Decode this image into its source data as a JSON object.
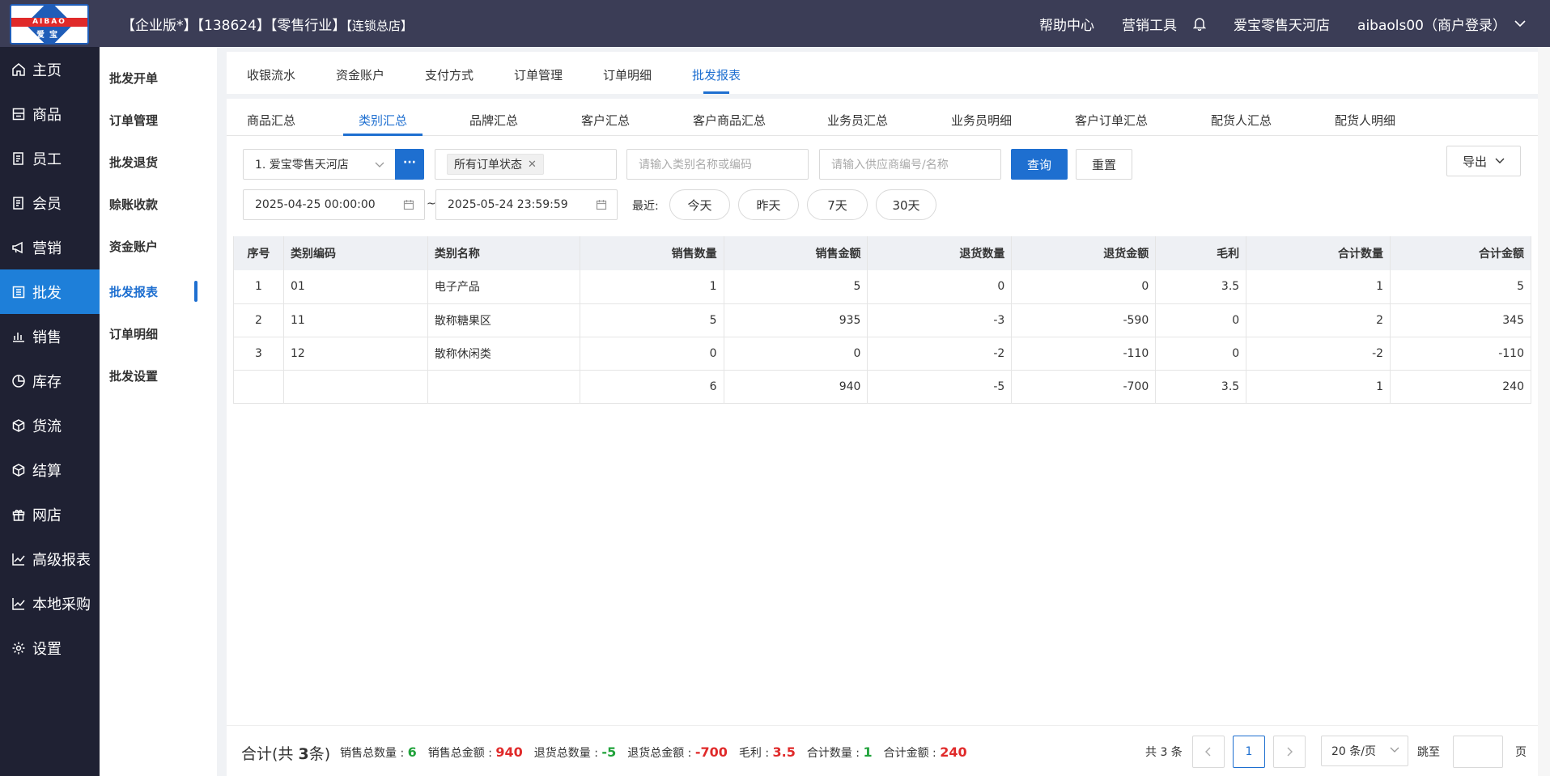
{
  "header": {
    "logo_text": "AIBAO",
    "logo_cn": "爱宝",
    "title_main": "【企业版*】【138624】【零售行业】",
    "title_small": "【连锁总店】",
    "help": "帮助中心",
    "marketing_tools": "营销工具",
    "store_name": "爱宝零售天河店",
    "user": "aibaols00（商户登录）"
  },
  "leftnav": [
    {
      "label": "主页",
      "icon": "home-icon"
    },
    {
      "label": "商品",
      "icon": "product-icon"
    },
    {
      "label": "员工",
      "icon": "staff-icon"
    },
    {
      "label": "会员",
      "icon": "member-icon"
    },
    {
      "label": "营销",
      "icon": "megaphone-icon"
    },
    {
      "label": "批发",
      "icon": "wholesale-icon"
    },
    {
      "label": "销售",
      "icon": "bar-chart-icon"
    },
    {
      "label": "库存",
      "icon": "pie-chart-icon"
    },
    {
      "label": "货流",
      "icon": "cube-icon"
    },
    {
      "label": "结算",
      "icon": "cube-icon"
    },
    {
      "label": "网店",
      "icon": "gift-icon"
    },
    {
      "label": "高级报表",
      "icon": "line-chart-icon"
    },
    {
      "label": "本地采购",
      "icon": "line-chart-icon"
    },
    {
      "label": "设置",
      "icon": "gear-icon"
    }
  ],
  "subnav": [
    "批发开单",
    "订单管理",
    "批发退货",
    "赊账收款",
    "资金账户",
    "批发报表",
    "订单明细",
    "批发设置"
  ],
  "tabs1": [
    "收银流水",
    "资金账户",
    "支付方式",
    "订单管理",
    "订单明细",
    "批发报表"
  ],
  "tabs2": [
    "商品汇总",
    "类别汇总",
    "品牌汇总",
    "客户汇总",
    "客户商品汇总",
    "业务员汇总",
    "业务员明细",
    "客户订单汇总",
    "配货人汇总",
    "配货人明细"
  ],
  "filters": {
    "store": "1. 爱宝零售天河店",
    "dots": "···",
    "status_tag": "所有订单状态",
    "category_placeholder": "请输入类别名称或编码",
    "supplier_placeholder": "请输入供应商编号/名称",
    "query": "查询",
    "reset": "重置",
    "export": "导出",
    "date_start": "2025-04-25 00:00:00",
    "date_sep": "~",
    "date_end": "2025-05-24 23:59:59",
    "recent_label": "最近:",
    "quick": [
      "今天",
      "昨天",
      "7天",
      "30天"
    ]
  },
  "table": {
    "headers": [
      "序号",
      "类别编码",
      "类别名称",
      "销售数量",
      "销售金额",
      "退货数量",
      "退货金额",
      "毛利",
      "合计数量",
      "合计金额"
    ],
    "rows": [
      [
        "1",
        "01",
        "电子产品",
        "1",
        "5",
        "0",
        "0",
        "3.5",
        "1",
        "5"
      ],
      [
        "2",
        "11",
        "散称糖果区",
        "5",
        "935",
        "-3",
        "-590",
        "0",
        "2",
        "345"
      ],
      [
        "3",
        "12",
        "散称休闲类",
        "0",
        "0",
        "-2",
        "-110",
        "0",
        "-2",
        "-110"
      ]
    ],
    "total_row": [
      "",
      "",
      "",
      "6",
      "940",
      "-5",
      "-700",
      "3.5",
      "1",
      "240"
    ]
  },
  "summary": {
    "prefix": "合计(共 ",
    "count": "3",
    "suffix": "条)",
    "items": [
      {
        "label": "销售总数量 : ",
        "value": "6",
        "color": "g"
      },
      {
        "label": "销售总金额 : ",
        "value": "940",
        "color": "r"
      },
      {
        "label": "退货总数量 : ",
        "value": "-5",
        "color": "g"
      },
      {
        "label": "退货总金额 : ",
        "value": "-700",
        "color": "r"
      },
      {
        "label": "毛利 : ",
        "value": "3.5",
        "color": "r"
      },
      {
        "label": "合计数量 : ",
        "value": "1",
        "color": "g"
      },
      {
        "label": "合计金额 : ",
        "value": "240",
        "color": "r"
      }
    ]
  },
  "pager": {
    "total": "共 3 条",
    "current": "1",
    "page_size": "20 条/页",
    "jump": "跳至",
    "unit": "页"
  }
}
